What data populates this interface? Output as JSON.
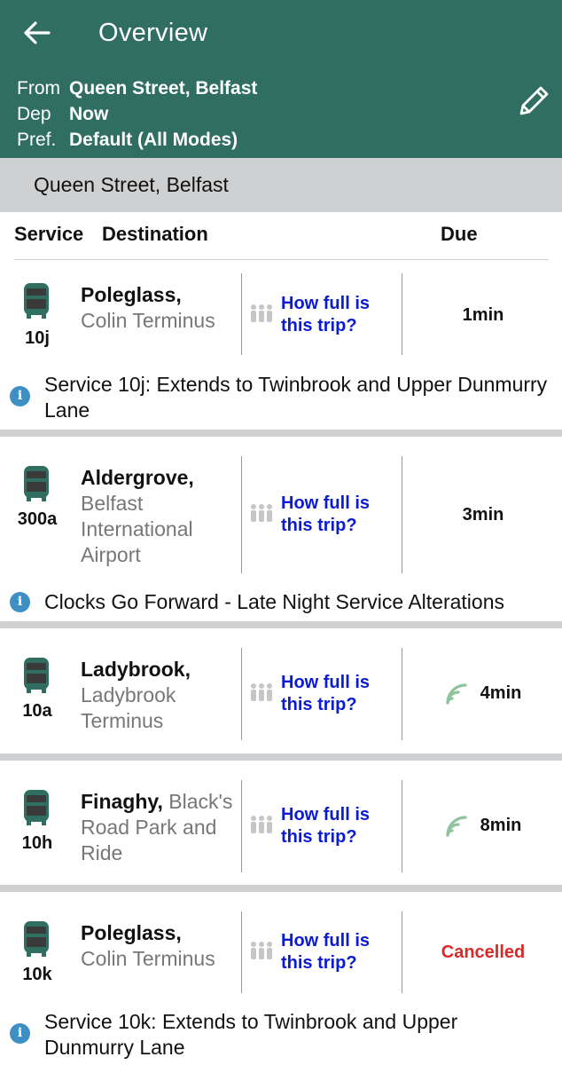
{
  "header": {
    "title": "Overview",
    "from_key": "From",
    "from_val": "Queen Street, Belfast",
    "dep_key": "Dep",
    "dep_val": "Now",
    "pref_key": "Pref.",
    "pref_val": "Default (All Modes)"
  },
  "stop": {
    "name": "Queen Street, Belfast"
  },
  "columns": {
    "service": "Service",
    "destination": "Destination",
    "due": "Due"
  },
  "occupancy_label_line1": "How full is",
  "occupancy_label_line2": "this trip?",
  "departures": [
    {
      "route": "10j",
      "dest": "Poleglass,",
      "sub": "Colin Terminus",
      "due": "1min",
      "realtime": false,
      "notice": "Service 10j: Extends to Twinbrook and Upper Dunmurry Lane"
    },
    {
      "route": "300a",
      "dest": "Aldergrove,",
      "sub": "Belfast International Airport",
      "due": "3min",
      "realtime": false,
      "notice": "Clocks Go Forward - Late Night Service Alterations"
    },
    {
      "route": "10a",
      "dest": "Ladybrook,",
      "sub": "Ladybrook Terminus",
      "due": "4min",
      "realtime": true,
      "notice": ""
    },
    {
      "route": "10h",
      "dest": "Finaghy,",
      "sub": "Black's Road Park and Ride",
      "due": "8min",
      "realtime": true,
      "notice": ""
    },
    {
      "route": "10k",
      "dest": "Poleglass,",
      "sub": "Colin Terminus",
      "due": "Cancelled",
      "realtime": false,
      "cancelled": true,
      "notice": "Service 10k: Extends to Twinbrook and Upper Dunmurry Lane"
    }
  ],
  "icons": {
    "back": "arrow-left-icon",
    "edit": "pencil-icon",
    "bus": "bus-icon",
    "occupancy": "people-icon",
    "realtime": "realtime-signal-icon",
    "info": "info-icon"
  },
  "colors": {
    "header": "#2f6e61",
    "link": "#0a1bd1",
    "cancelled": "#d62b27",
    "realtime": "#8fc39c",
    "info": "#3d8fc4"
  }
}
